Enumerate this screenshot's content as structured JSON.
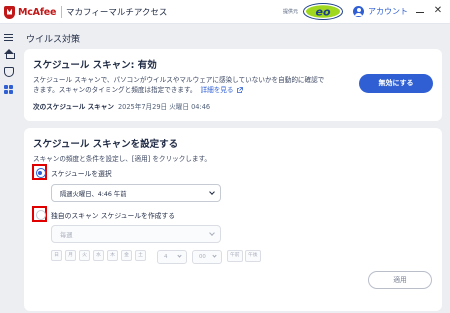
{
  "titlebar": {
    "brand": "McAfee",
    "app_title": "マカフィーマルチアクセス",
    "provider_label": "提供元",
    "provider_logo_text": "eo",
    "account_label": "アカウント",
    "minimize_symbol": "—",
    "close_symbol": "✕"
  },
  "sidebar": {
    "icons": [
      "menu-icon",
      "home-icon",
      "shield-icon",
      "grid-icon"
    ],
    "active_color": "#2f5fd3"
  },
  "page": {
    "title": "ウイルス対策"
  },
  "status_card": {
    "title": "スケジュール スキャン: 有効",
    "desc_line1": "スケジュール スキャンで、パソコンがウイルスやマルウェアに感染していないかを自動的に確認で",
    "desc_line2": "きます。スキャンのタイミングと頻度は指定できます。",
    "details_link": "詳細を見る",
    "next_scan_label": "次のスケジュール スキャン",
    "next_scan_value": "2025年7月29日 火曜日 04:46",
    "enable_button": "無効にする"
  },
  "settings_card": {
    "title": "スケジュール スキャンを設定する",
    "description": "スキャンの頻度と条件を設定し、[適用] をクリックします。",
    "option_select": {
      "label": "スケジュールを選択",
      "selected": true,
      "value": "隔週火曜日、4:46 午前"
    },
    "option_custom": {
      "label": "独自のスキャン スケジュールを作成する",
      "selected": false,
      "frequency_value": "毎週",
      "days": [
        "日",
        "月",
        "火",
        "水",
        "木",
        "金",
        "土"
      ],
      "hour": "4",
      "minute": "00",
      "am": "午前",
      "pm": "午後"
    },
    "apply_button": "適用"
  },
  "colors": {
    "accent": "#2f5fd3",
    "brand_red": "#c01818",
    "highlight_red": "#e00000"
  }
}
